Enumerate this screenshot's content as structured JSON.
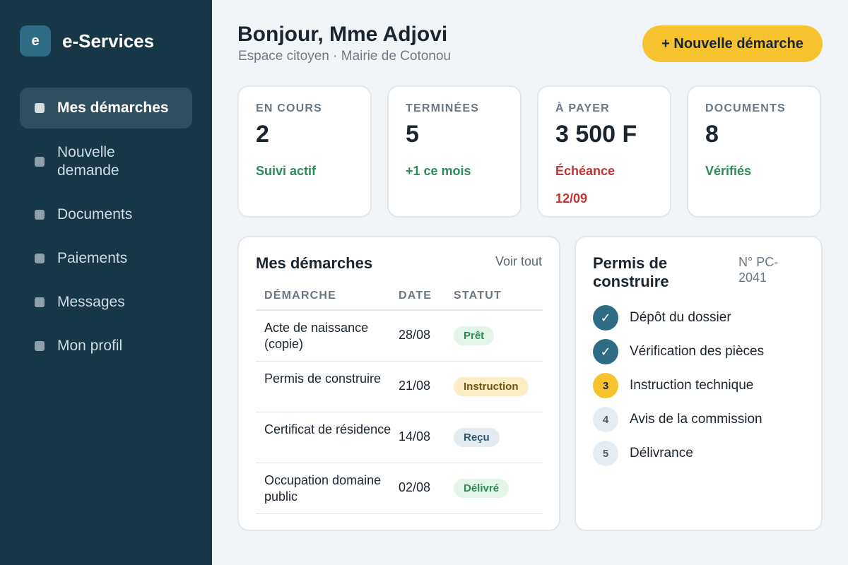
{
  "brand": {
    "logo_letter": "e",
    "name": "e-Services"
  },
  "nav": [
    {
      "label": "Mes démarches",
      "active": true
    },
    {
      "label": "Nouvelle demande",
      "active": false
    },
    {
      "label": "Documents",
      "active": false
    },
    {
      "label": "Paiements",
      "active": false
    },
    {
      "label": "Messages",
      "active": false
    },
    {
      "label": "Mon profil",
      "active": false
    }
  ],
  "header": {
    "greeting": "Bonjour, Mme Adjovi",
    "subtitle": "Espace citoyen · Mairie de Cotonou",
    "new_button": "+ Nouvelle démarche"
  },
  "stats": [
    {
      "label": "EN COURS",
      "value": "2",
      "note": "Suivi actif",
      "note_color": "#2b8c55"
    },
    {
      "label": "TERMINÉES",
      "value": "5",
      "note": "+1 ce mois",
      "note_color": "#2b8c55"
    },
    {
      "label": "À PAYER",
      "value": "3 500 F",
      "note": "Échéance 12/09",
      "note_color": "#c0352f"
    },
    {
      "label": "DOCUMENTS",
      "value": "8",
      "note": "Vérifiés",
      "note_color": "#2b8c55"
    }
  ],
  "procedures": {
    "title": "Mes démarches",
    "see_all": "Voir tout",
    "columns": [
      "DÉMARCHE",
      "DATE",
      "STATUT"
    ],
    "rows": [
      {
        "name": "Acte de naissance (copie)",
        "date": "28/08",
        "status": "Prêt",
        "status_kind": "ready"
      },
      {
        "name": "Permis de construire",
        "date": "21/08",
        "status": "Instruction",
        "status_kind": "instr"
      },
      {
        "name": "Certificat de résidence",
        "date": "14/08",
        "status": "Reçu",
        "status_kind": "recu"
      },
      {
        "name": "Occupation domaine public",
        "date": "02/08",
        "status": "Délivré",
        "status_kind": "deliv"
      }
    ]
  },
  "permit": {
    "title": "Permis de construire",
    "number": "N° PC-2041",
    "steps": [
      {
        "marker": "✓",
        "label": "Dépôt du dossier",
        "state": "done"
      },
      {
        "marker": "✓",
        "label": "Vérification des pièces",
        "state": "done"
      },
      {
        "marker": "3",
        "label": "Instruction technique",
        "state": "current"
      },
      {
        "marker": "4",
        "label": "Avis de la commission",
        "state": "todo"
      },
      {
        "marker": "5",
        "label": "Délivrance",
        "state": "todo"
      }
    ]
  }
}
